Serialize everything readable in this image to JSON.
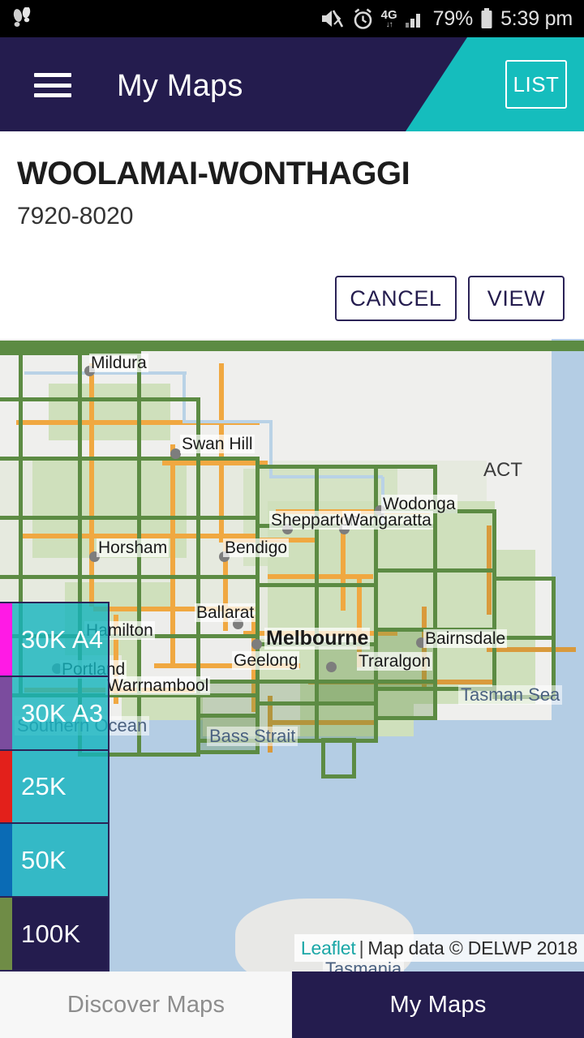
{
  "status_bar": {
    "left_icon": "footsteps-icon",
    "icons": [
      "mute-vibrate-icon",
      "alarm-clock-icon",
      "4g-data-icon",
      "signal-bars-icon",
      "battery-icon"
    ],
    "network_label": "4G",
    "battery_percent": "79%",
    "time": "5:39 pm"
  },
  "app_bar": {
    "menu_icon": "hamburger-menu-icon",
    "title": "My Maps",
    "list_button": "LIST",
    "bg_color": "#241c4e",
    "accent_color": "#15BDBD"
  },
  "info_card": {
    "title": "WOOLAMAI-WONTHAGGI",
    "subtitle": "7920-8020",
    "cancel_label": "CANCEL",
    "view_label": "VIEW"
  },
  "map": {
    "grid_color": "#5c8b43",
    "attribution": {
      "link": "Leaflet",
      "separator": "|",
      "text": "Map data © DELWP 2018"
    },
    "city_labels": [
      "Mildura",
      "Swan Hill",
      "Horsham",
      "Bendigo",
      "Shepparton",
      "Wangaratta",
      "Wodonga",
      "Ballarat",
      "Melbourne",
      "Geelong",
      "Traralgon",
      "Bairnsdale",
      "Hamilton",
      "Portland",
      "Warrnambool"
    ],
    "sea_labels": [
      "Southern Ocean",
      "Bass Strait",
      "Tasman Sea",
      "Tasmania"
    ],
    "state_labels": [
      "ACT"
    ]
  },
  "legend": {
    "items": [
      {
        "label": "30K A4",
        "color": "#ff1ae5",
        "selected": false
      },
      {
        "label": "30K A3",
        "color": "#7b4c9e",
        "selected": false
      },
      {
        "label": "25K",
        "color": "#e3201b",
        "selected": false
      },
      {
        "label": "50K",
        "color": "#0a6bb5",
        "selected": false
      },
      {
        "label": "100K",
        "color": "#6f8c46",
        "selected": true
      }
    ]
  },
  "bottom_nav": {
    "tabs": [
      {
        "label": "Discover Maps",
        "active": false
      },
      {
        "label": "My Maps",
        "active": true
      }
    ]
  }
}
